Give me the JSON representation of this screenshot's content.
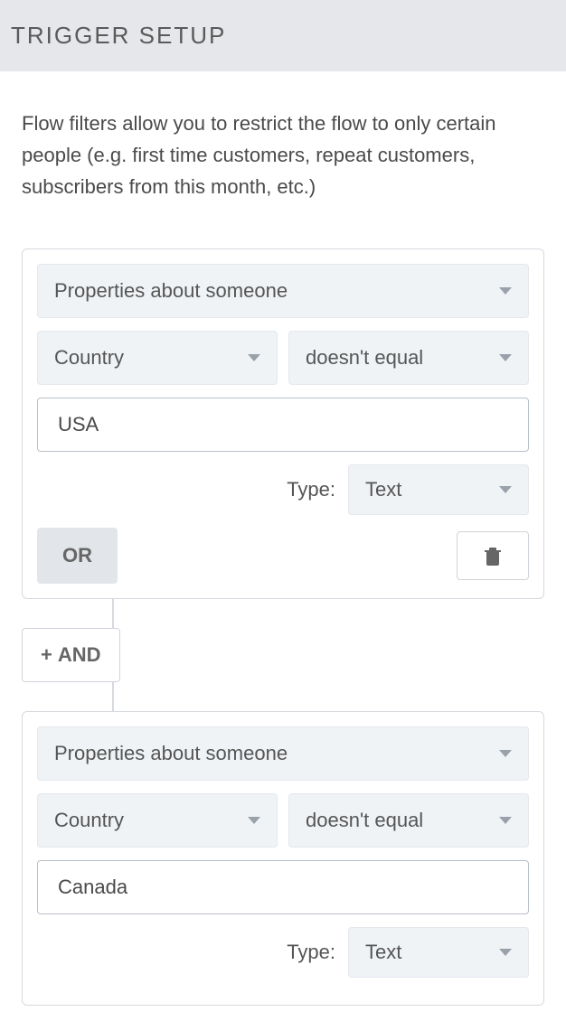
{
  "header": {
    "title": "TRIGGER SETUP"
  },
  "description": "Flow filters allow you to restrict the flow to only certain people (e.g. first time customers, repeat customers, subscribers from this month, etc.)",
  "filters": [
    {
      "category": "Properties about someone",
      "property": "Country",
      "operator": "doesn't equal",
      "value": "USA",
      "type_label": "Type:",
      "type_value": "Text",
      "or_label": "OR"
    },
    {
      "category": "Properties about someone",
      "property": "Country",
      "operator": "doesn't equal",
      "value": "Canada",
      "type_label": "Type:",
      "type_value": "Text"
    }
  ],
  "and_label": "AND"
}
